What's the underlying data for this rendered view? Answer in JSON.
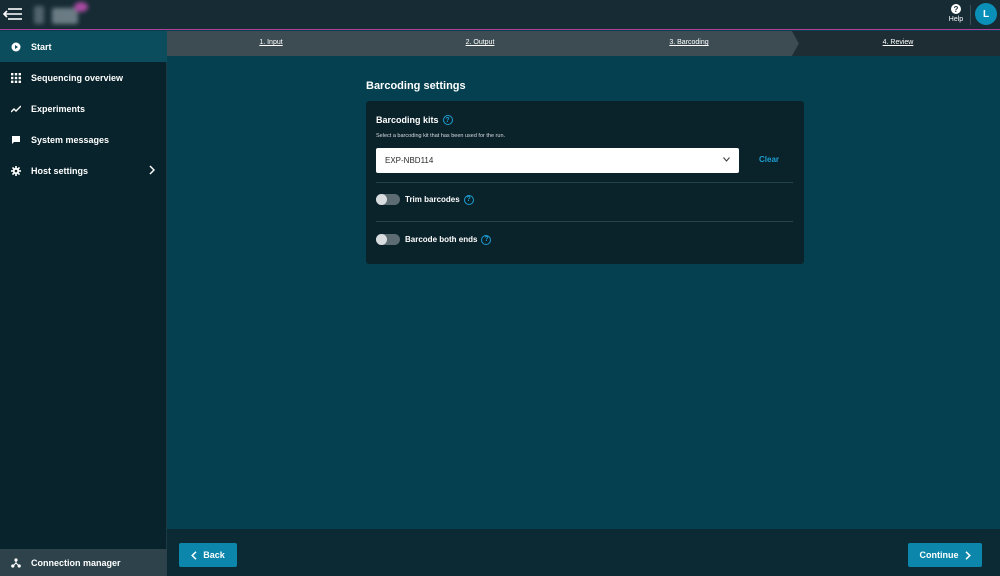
{
  "topbar": {
    "help_label": "Help",
    "help_glyph": "?",
    "avatar_initial": "L",
    "menu_icon": "menu-collapse-icon",
    "colors": {
      "accent": "#b0409a",
      "avatar": "#0a8fb8"
    }
  },
  "sidebar": {
    "items": [
      {
        "label": "Start",
        "icon": "play-circle-icon",
        "active": true
      },
      {
        "label": "Sequencing overview",
        "icon": "grid-icon",
        "active": false
      },
      {
        "label": "Experiments",
        "icon": "trend-line-icon",
        "active": false
      },
      {
        "label": "System messages",
        "icon": "message-icon",
        "active": false
      },
      {
        "label": "Host settings",
        "icon": "gear-icon",
        "active": false
      }
    ],
    "connection_manager": "Connection manager"
  },
  "stepper": {
    "steps": [
      {
        "label": "1. Input"
      },
      {
        "label": "2. Output"
      },
      {
        "label": "3. Barcoding"
      },
      {
        "label": "4. Review"
      }
    ]
  },
  "main": {
    "title": "Barcoding settings",
    "card": {
      "kits_label": "Barcoding kits",
      "kits_help": "Select a barcoding kit that has been used for the run.",
      "selected_kit": "EXP-NBD114",
      "clear_label": "Clear",
      "trim_label": "Trim barcodes",
      "trim_enabled": false,
      "both_ends_label": "Barcode both ends",
      "both_ends_enabled": false,
      "help_glyph": "?"
    }
  },
  "footer": {
    "back_label": "Back",
    "continue_label": "Continue"
  }
}
